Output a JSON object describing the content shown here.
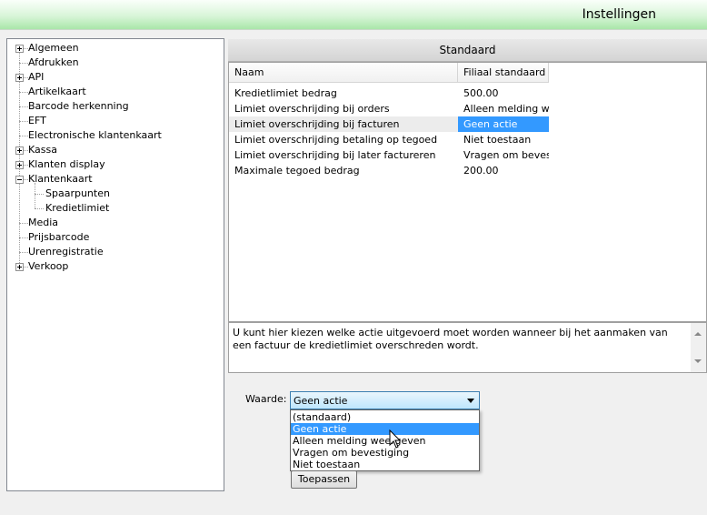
{
  "window": {
    "title": "Instellingen"
  },
  "tree": {
    "items": [
      {
        "label": "Algemeen",
        "expander": "plus"
      },
      {
        "label": "Afdrukken",
        "expander": "none"
      },
      {
        "label": "API",
        "expander": "plus"
      },
      {
        "label": "Artikelkaart",
        "expander": "none"
      },
      {
        "label": "Barcode herkenning",
        "expander": "none"
      },
      {
        "label": "EFT",
        "expander": "none"
      },
      {
        "label": "Electronische klantenkaart",
        "expander": "none"
      },
      {
        "label": "Kassa",
        "expander": "plus"
      },
      {
        "label": "Klanten display",
        "expander": "plus"
      },
      {
        "label": "Klantenkaart",
        "expander": "minus"
      },
      {
        "label": "Spaarpunten",
        "expander": "child"
      },
      {
        "label": "Kredietlimiet",
        "expander": "child"
      },
      {
        "label": "Media",
        "expander": "none"
      },
      {
        "label": "Prijsbarcode",
        "expander": "none"
      },
      {
        "label": "Urenregistratie",
        "expander": "none"
      },
      {
        "label": "Verkoop",
        "expander": "plus"
      }
    ]
  },
  "panel": {
    "title": "Standaard"
  },
  "grid": {
    "columns": [
      "Naam",
      "Filiaal standaard"
    ],
    "rows": [
      {
        "name": "Kredietlimiet bedrag",
        "value": "500.00"
      },
      {
        "name": "Limiet overschrijding bij orders",
        "value": "Alleen melding weergeven"
      },
      {
        "name": "Limiet overschrijding bij facturen",
        "value": "Geen actie",
        "selected": true
      },
      {
        "name": "Limiet overschrijding betaling op tegoed",
        "value": "Niet toestaan"
      },
      {
        "name": "Limiet overschrijding bij later factureren",
        "value": "Vragen om bevestiging"
      },
      {
        "name": "Maximale tegoed bedrag",
        "value": "200.00"
      }
    ]
  },
  "description": "U kunt hier kiezen welke actie uitgevoerd moet worden wanneer bij het aanmaken van een factuur de kredietlimiet overschreden wordt.",
  "waarde": {
    "label": "Waarde:",
    "selected": "Geen actie",
    "options": [
      "(standaard)",
      "Geen actie",
      "Alleen melding weergeven",
      "Vragen om bevestiging",
      "Niet toestaan"
    ],
    "highlighted_index": 1
  },
  "apply_button": "Toepassen",
  "colors": {
    "selection": "#3399ff",
    "titlebar_green": "#a9e6a9"
  }
}
